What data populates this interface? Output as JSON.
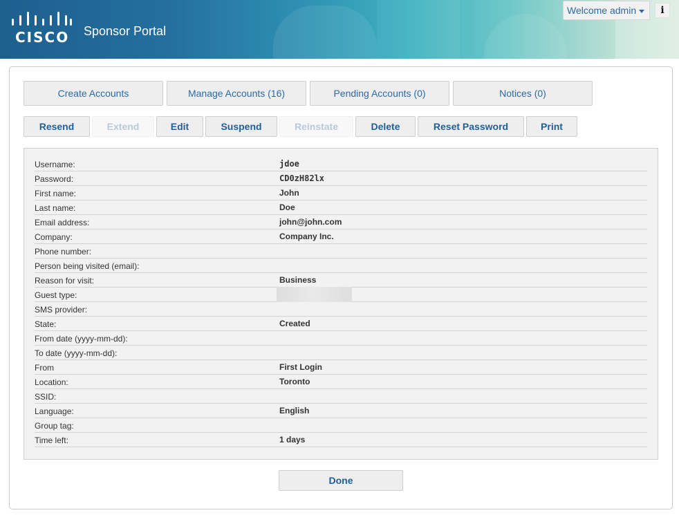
{
  "header": {
    "logo_text": "CISCO",
    "portal_title": "Sponsor Portal",
    "welcome": "Welcome admin",
    "info_label": "i"
  },
  "tabs": [
    {
      "label": "Create Accounts"
    },
    {
      "label": "Manage Accounts (16)"
    },
    {
      "label": "Pending Accounts (0)"
    },
    {
      "label": "Notices (0)"
    }
  ],
  "actions": [
    {
      "label": "Resend",
      "enabled": true
    },
    {
      "label": "Extend",
      "enabled": false
    },
    {
      "label": "Edit",
      "enabled": true
    },
    {
      "label": "Suspend",
      "enabled": true
    },
    {
      "label": "Reinstate",
      "enabled": false
    },
    {
      "label": "Delete",
      "enabled": true
    },
    {
      "label": "Reset Password",
      "enabled": true
    },
    {
      "label": "Print",
      "enabled": true
    }
  ],
  "details": [
    {
      "label": "Username:",
      "value": "jdoe"
    },
    {
      "label": "Password:",
      "value": "CD0zH82lx"
    },
    {
      "label": "First name:",
      "value": "John"
    },
    {
      "label": "Last name:",
      "value": "Doe"
    },
    {
      "label": "Email address:",
      "value": "john@john.com"
    },
    {
      "label": "Company:",
      "value": "Company Inc."
    },
    {
      "label": "Phone number:",
      "value": ""
    },
    {
      "label": "Person being visited (email):",
      "value": ""
    },
    {
      "label": "Reason for visit:",
      "value": "Business"
    },
    {
      "label": "Guest type:",
      "value": ""
    },
    {
      "label": "SMS provider:",
      "value": ""
    },
    {
      "label": "State:",
      "value": "Created"
    },
    {
      "label": "From date (yyyy-mm-dd):",
      "value": ""
    },
    {
      "label": "To date (yyyy-mm-dd):",
      "value": ""
    },
    {
      "label": "From",
      "value": "First Login"
    },
    {
      "label": "Location:",
      "value": "Toronto"
    },
    {
      "label": "SSID:",
      "value": ""
    },
    {
      "label": "Language:",
      "value": "English"
    },
    {
      "label": "Group tag:",
      "value": ""
    },
    {
      "label": "Time left:",
      "value": "1 days"
    }
  ],
  "done_label": "Done"
}
